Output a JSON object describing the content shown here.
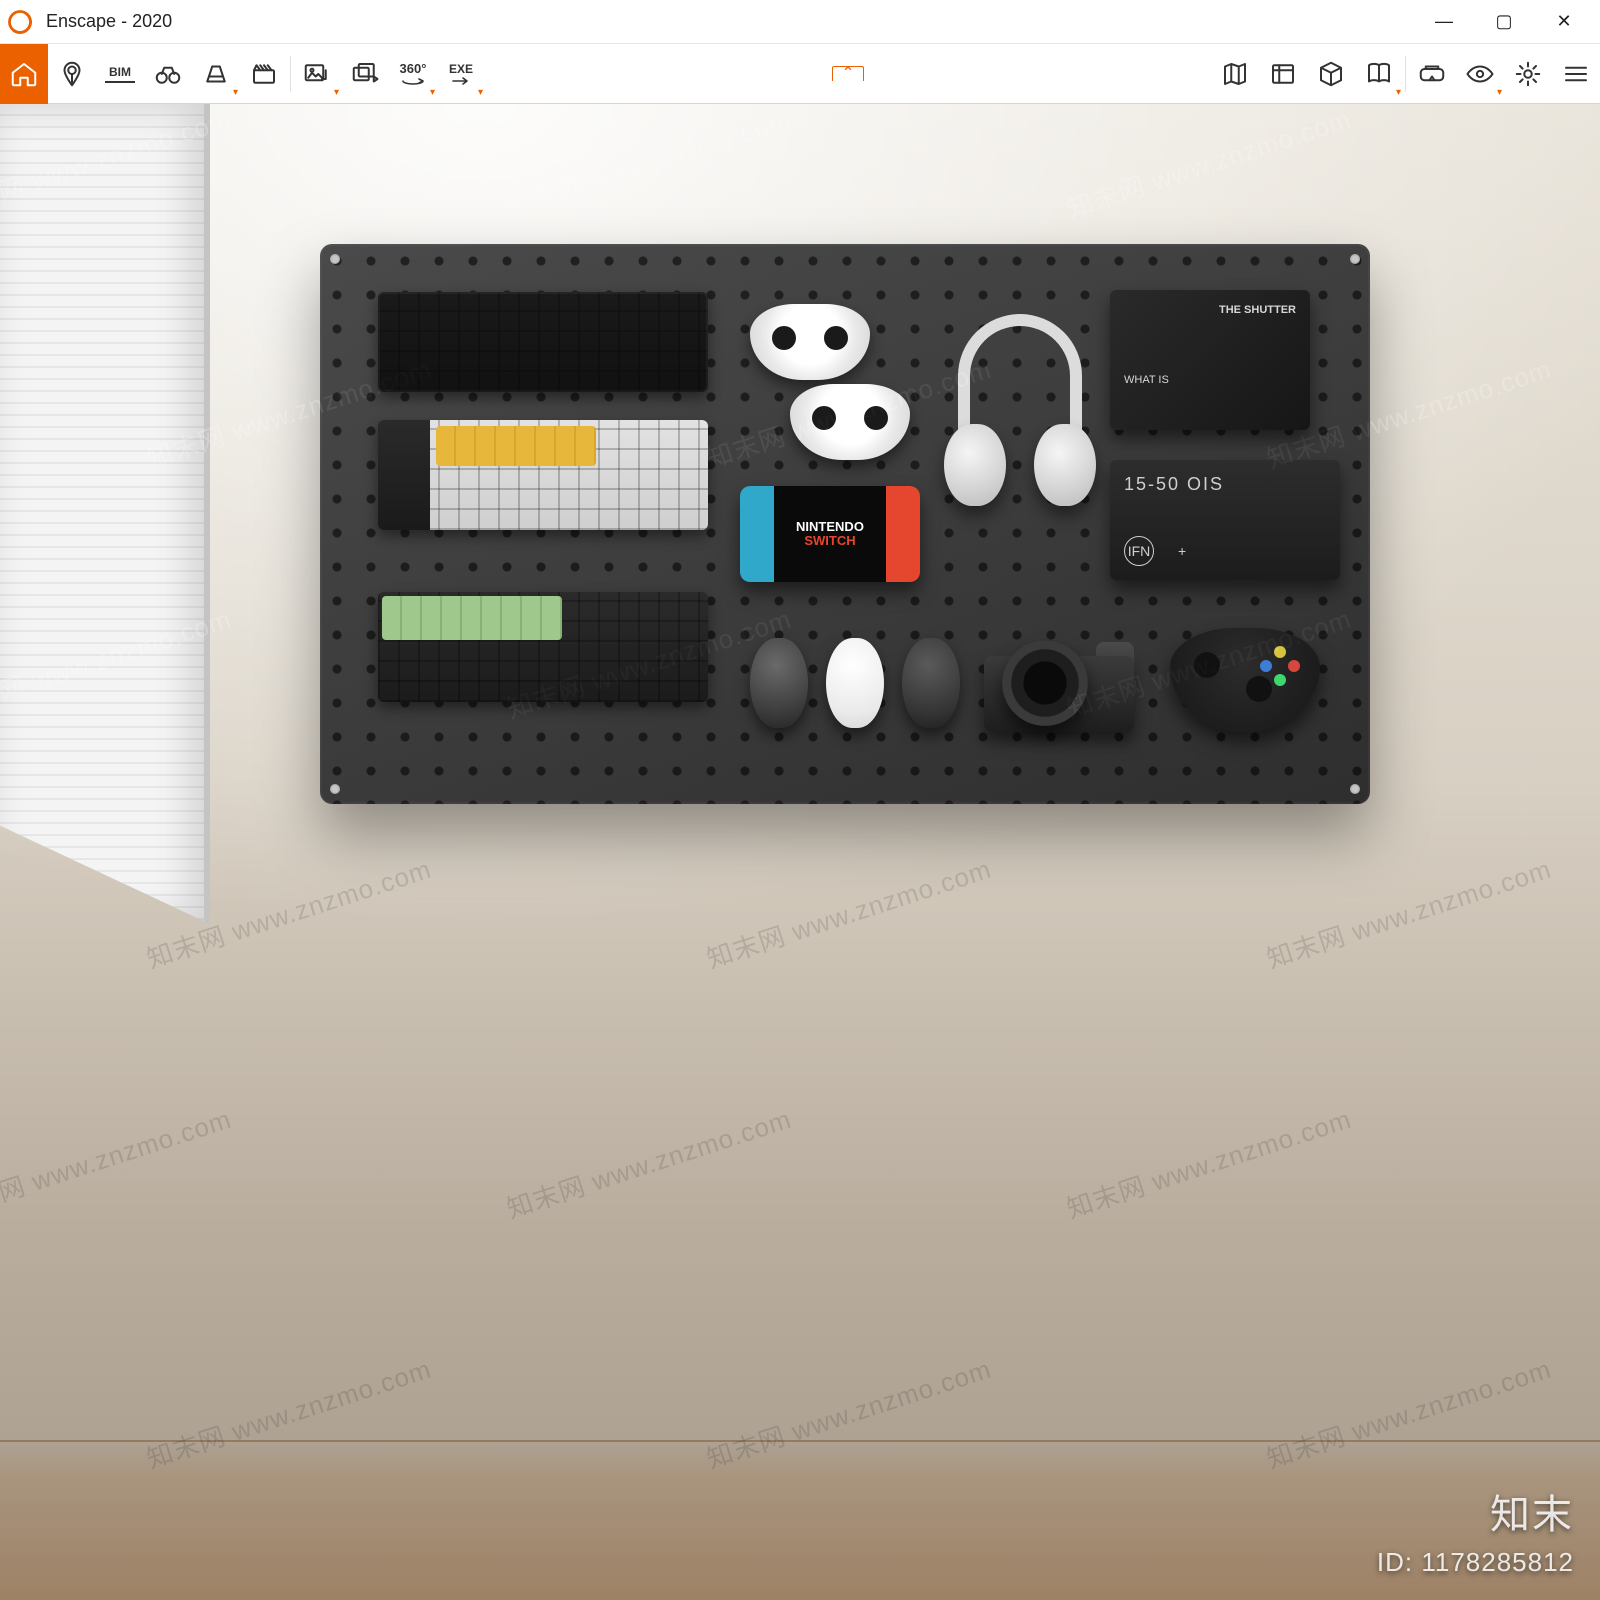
{
  "titlebar": {
    "app_name": "Enscape",
    "document_name": "2020",
    "separator": " - ",
    "window_buttons": {
      "minimize": "—",
      "maximize": "▢",
      "close": "✕"
    }
  },
  "toolbar": {
    "left": [
      {
        "name": "home-icon",
        "kind": "icon",
        "active": true,
        "interact": true,
        "caret": false
      },
      {
        "name": "pin-icon",
        "kind": "icon",
        "active": false,
        "interact": true,
        "caret": false
      },
      {
        "name": "bim-label",
        "kind": "text",
        "text": "BIM",
        "interact": true,
        "underline": true
      },
      {
        "name": "binoculars-icon",
        "kind": "icon",
        "active": false,
        "interact": true,
        "caret": false
      },
      {
        "name": "perspective-icon",
        "kind": "icon",
        "active": false,
        "interact": true,
        "caret": true
      },
      {
        "name": "clapper-icon",
        "kind": "icon",
        "active": false,
        "interact": true,
        "caret": false
      }
    ],
    "mid": [
      {
        "name": "export-image-icon",
        "kind": "icon",
        "interact": true,
        "caret": true
      },
      {
        "name": "batch-render-icon",
        "kind": "icon",
        "interact": true,
        "caret": false
      },
      {
        "name": "panorama-360-icon",
        "kind": "text",
        "text": "360°",
        "interact": true,
        "caret": true
      },
      {
        "name": "export-exe-icon",
        "kind": "text",
        "text": "EXE",
        "interact": true,
        "caret": true
      }
    ],
    "right": [
      {
        "name": "map-icon",
        "interact": true,
        "caret": false
      },
      {
        "name": "assets-icon",
        "interact": true,
        "caret": false
      },
      {
        "name": "cube-icon",
        "interact": true,
        "caret": false
      },
      {
        "name": "book-open-icon",
        "interact": true,
        "caret": true
      },
      {
        "name": "vr-headset-icon",
        "interact": true,
        "caret": false
      },
      {
        "name": "eye-icon",
        "interact": true,
        "caret": true
      },
      {
        "name": "gear-icon",
        "interact": true,
        "caret": false
      },
      {
        "name": "menu-icon",
        "interact": true,
        "caret": false
      }
    ],
    "collapse_caret": "⌃"
  },
  "scene": {
    "switch_logo_top": "NINTENDO",
    "switch_logo_bottom": "SWITCH",
    "media_box": {
      "title": "THE SHUTTER",
      "sub": "WHAT IS"
    },
    "lens_box": {
      "big": "15-50 OIS",
      "if_label": "IFN",
      "plus": "+"
    }
  },
  "watermark": {
    "repeat_text": "知末网 www.znzmo.com",
    "brand": "知末",
    "id_label": "ID: 1178285812"
  },
  "colors": {
    "accent": "#eb6100"
  }
}
